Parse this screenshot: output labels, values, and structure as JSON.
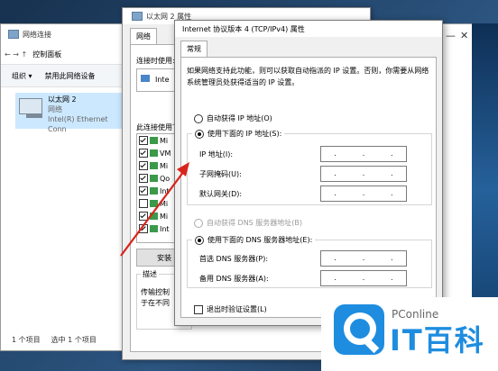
{
  "netconn": {
    "title": "网络连接",
    "nav": "←  →  ↑",
    "breadcrumb": "控制面板",
    "organize": "组织 ▾",
    "disable": "禁用此网络设备",
    "item_name": "以太网 2",
    "item_status": "网络",
    "item_adapter": "Intel(R) Ethernet Conn",
    "status_left": "1 个项目",
    "status_right": "选中 1 个项目"
  },
  "eth": {
    "title": "以太网 2 属性",
    "tab": "网络",
    "connect_using": "连接时使用:",
    "adapter": "Inte",
    "uses": "此连接使用下",
    "components": [
      {
        "label": "Mi",
        "checked": true
      },
      {
        "label": "VM",
        "checked": true
      },
      {
        "label": "Mi",
        "checked": true
      },
      {
        "label": "Qo",
        "checked": true
      },
      {
        "label": "Int",
        "checked": true
      },
      {
        "label": "Mi",
        "checked": false
      },
      {
        "label": "Mi",
        "checked": true
      },
      {
        "label": "Int",
        "checked": true
      }
    ],
    "install": "安装",
    "desc_legend": "描述",
    "desc_line1": "传输控制",
    "desc_line2": "于在不同"
  },
  "ipv4": {
    "title": "Internet 协议版本 4 (TCP/IPv4) 属性",
    "tab": "常规",
    "intro": "如果网络支持此功能，则可以获取自动指派的 IP 设置。否则，你需要从网络系统管理员处获得适当的 IP 设置。",
    "auto_ip": "自动获得 IP 地址(O)",
    "manual_ip": "使用下面的 IP 地址(S):",
    "ip_label": "IP 地址(I):",
    "mask_label": "子网掩码(U):",
    "gateway_label": "默认网关(D):",
    "auto_dns": "自动获得 DNS 服务器地址(B)",
    "manual_dns": "使用下面的 DNS 服务器地址(E):",
    "dns1_label": "首选 DNS 服务器(P):",
    "dns2_label": "备用 DNS 服务器(A):",
    "exit_validate": "退出时验证设置(L)"
  },
  "watermark": {
    "sub": "PConline",
    "main": "IT百科"
  }
}
